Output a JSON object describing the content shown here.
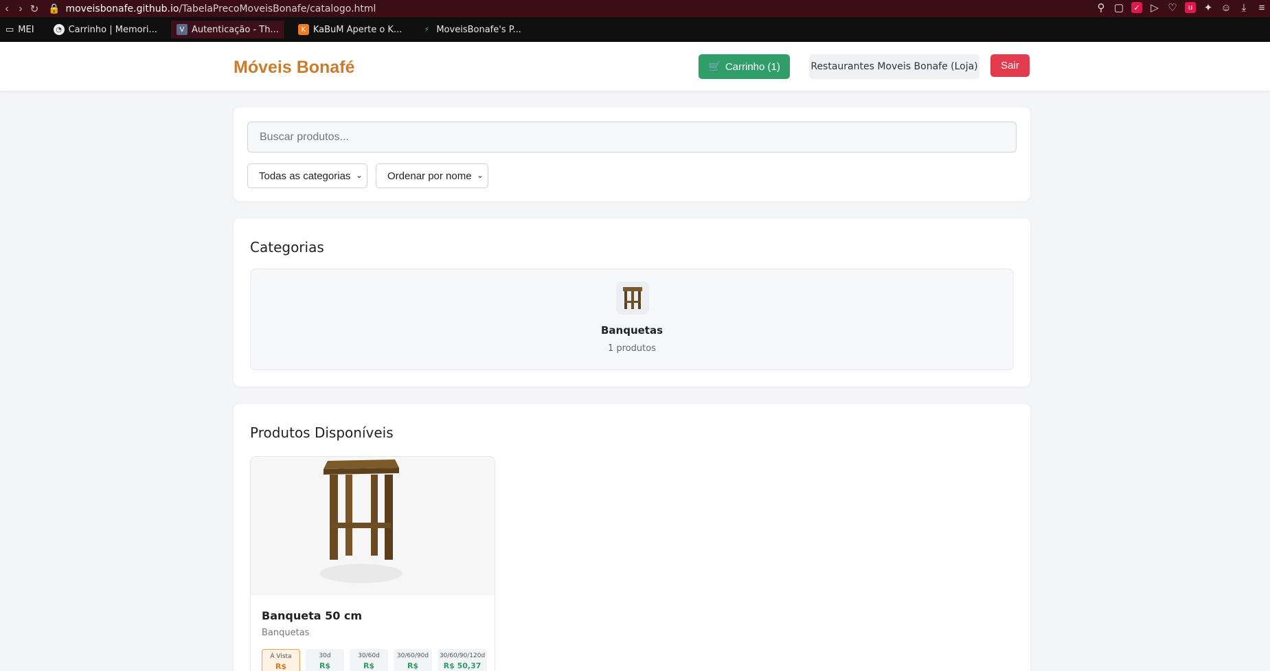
{
  "browser": {
    "url_host": "moveisbonafe.github.io",
    "url_path": "/TabelaPrecoMoveisBonafe/catalogo.html",
    "bookmarks": [
      {
        "label": "MEI"
      },
      {
        "label": "Carrinho | Memori..."
      },
      {
        "label": "Autenticação - Th..."
      },
      {
        "label": "KaBuM Aperte o K..."
      },
      {
        "label": "MoveisBonafe's P..."
      }
    ]
  },
  "header": {
    "brand": "Móveis Bonafé",
    "cart_label": "Carrinho (1)",
    "store_label": "Restaurantes Moveis Bonafe (Loja)",
    "exit_label": "Sair"
  },
  "search": {
    "placeholder": "Buscar produtos...",
    "category_select": "Todas as categorias",
    "order_select": "Ordenar por nome"
  },
  "categories": {
    "title": "Categorias",
    "items": [
      {
        "name": "Banquetas",
        "count": "1 produtos"
      }
    ]
  },
  "products": {
    "title": "Produtos Disponíveis",
    "items": [
      {
        "name": "Banqueta 50 cm",
        "category": "Banquetas",
        "prices": [
          {
            "term": "À Vista",
            "value": "R$"
          },
          {
            "term": "30d",
            "value": "R$"
          },
          {
            "term": "30/60d",
            "value": "R$"
          },
          {
            "term": "30/60/90d",
            "value": "R$"
          },
          {
            "term": "30/60/90/120d",
            "value": "R$ 50,37"
          }
        ]
      }
    ]
  },
  "colors": {
    "brand": "#cc7a2c",
    "cart_button": "#2f9e69",
    "exit_button": "#e23b4e",
    "browser_bar": "#3b0d14"
  }
}
